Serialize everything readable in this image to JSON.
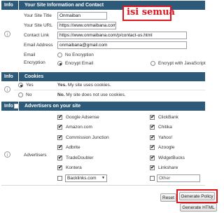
{
  "annotation": {
    "text": "isi semua"
  },
  "section1": {
    "info": "Info",
    "title": "Your Site Information and Contact",
    "rows": [
      {
        "label": "Your Site Title",
        "value": "Onmaiban"
      },
      {
        "label": "Your Site URL",
        "value": "https://www.onmaibana.com"
      },
      {
        "label": "Contact Link",
        "value": "https://www.onmaibana.com/p/contact-us.html"
      },
      {
        "label": "Email Address",
        "value": "onmaibana@gmail.com"
      }
    ],
    "email_label": "Email",
    "encryption_label": "Encryption",
    "radio_no": "No Encryption",
    "radio_encrypt": "Encrypt Email",
    "radio_js": "Encrypt with JavaScript"
  },
  "section2": {
    "info": "Info",
    "title": "Cookies",
    "yes_label": "Yes",
    "yes_bold": "Yes.",
    "yes_text": " My site uses cookies.",
    "no_label": "No",
    "no_bold": "No.",
    "no_text": " My site does not use cookies."
  },
  "section3": {
    "info": "Info",
    "title": "Advertisers on your site",
    "advertisers_label": "Advertisers",
    "left": [
      "Google Adsense",
      "Amazon.com",
      "Commission Junction",
      "Adbrite",
      "TradeDoubler",
      "Kontera"
    ],
    "right": [
      "ClickBank",
      "Chitika",
      "Yahoo!",
      "Azoogle",
      "WidgetBucks",
      "Linkshare"
    ],
    "dropdown_value": "Backlinks.com",
    "other_placeholder": "Other"
  },
  "buttons": {
    "reset": "Reset",
    "generate_policy": "Generate Policy",
    "generate_html": "Generate HTML"
  },
  "colors": {
    "header": "#2c5a78",
    "highlight": "#e0161f",
    "annotation_text": "#e0161f"
  }
}
